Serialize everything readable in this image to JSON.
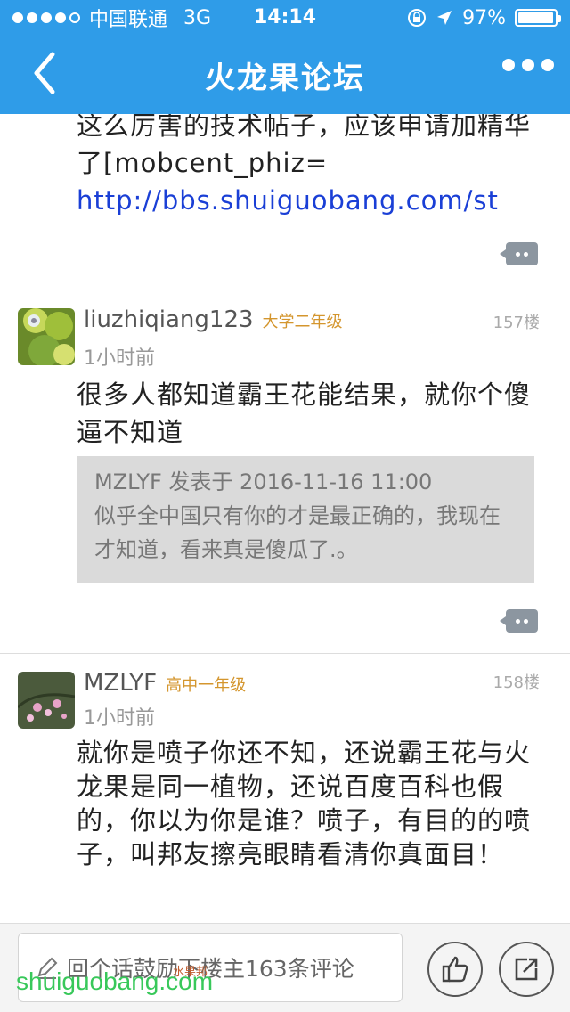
{
  "status_bar": {
    "carrier": "中国联通",
    "network": "3G",
    "time": "14:14",
    "battery": "97%",
    "battery_level": 0.97
  },
  "nav": {
    "title": "火龙果论坛",
    "back_icon": "chevron-left-icon",
    "more_icon": "more-dots-icon"
  },
  "posts": [
    {
      "text_line1": "这么厉害的技术帖子，应该申请加精华了[mobcent_phiz=",
      "link": "http://bbs.shuiguobang.com/st"
    },
    {
      "username": "liuzhiqiang123",
      "level": "大学二年级",
      "floor": "157楼",
      "time": "1小时前",
      "text": "很多人都知道霸王花能结果，就你个傻逼不知道",
      "quote_head": "MZLYF 发表于 2016-11-16 11:00",
      "quote_body": "似乎全中国只有你的才是最正确的，我现在才知道，看来真是傻瓜了.。"
    },
    {
      "username": "MZLYF",
      "level": "高中一年级",
      "floor": "158楼",
      "time": "1小时前",
      "text": "就你是喷子你还不知，还说霸王花与火龙果是同一植物，还说百度百科也假的，你以为你是谁？喷子，有目的的喷子，叫邦友擦亮眼睛看清你真面目！"
    }
  ],
  "bottom": {
    "comment_placeholder": "回个话鼓励下楼主163条评论",
    "watermark": "shuiguobang.com",
    "watermark_small": "水果邦"
  },
  "colors": {
    "header": "#2f9ce8",
    "level": "#d4962e",
    "link": "#1a3fd6"
  }
}
